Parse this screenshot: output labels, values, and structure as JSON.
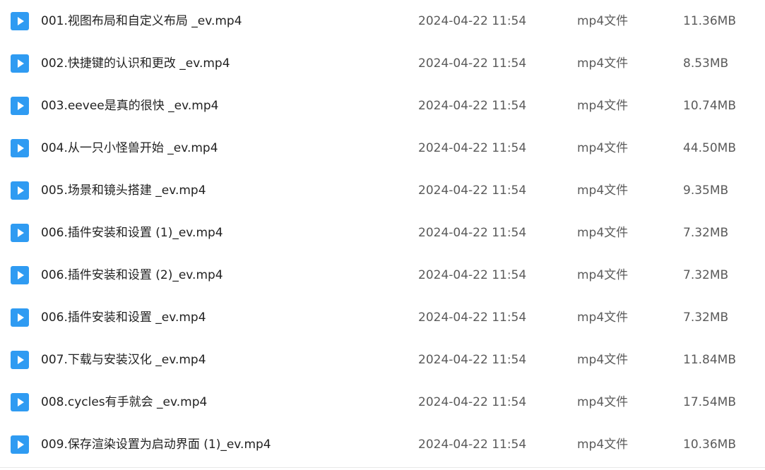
{
  "icons": {
    "file": "video-file-icon",
    "file_color": "#2f9bf2"
  },
  "files": [
    {
      "name": "001.视图布局和自定义布局 _ev.mp4",
      "modified": "2024-04-22 11:54",
      "type": "mp4文件",
      "size": "11.36MB"
    },
    {
      "name": "002.快捷键的认识和更改 _ev.mp4",
      "modified": "2024-04-22 11:54",
      "type": "mp4文件",
      "size": "8.53MB"
    },
    {
      "name": "003.eevee是真的很快 _ev.mp4",
      "modified": "2024-04-22 11:54",
      "type": "mp4文件",
      "size": "10.74MB"
    },
    {
      "name": "004.从一只小怪兽开始 _ev.mp4",
      "modified": "2024-04-22 11:54",
      "type": "mp4文件",
      "size": "44.50MB"
    },
    {
      "name": "005.场景和镜头搭建 _ev.mp4",
      "modified": "2024-04-22 11:54",
      "type": "mp4文件",
      "size": "9.35MB"
    },
    {
      "name": "006.插件安装和设置 (1)_ev.mp4",
      "modified": "2024-04-22 11:54",
      "type": "mp4文件",
      "size": "7.32MB"
    },
    {
      "name": "006.插件安装和设置 (2)_ev.mp4",
      "modified": "2024-04-22 11:54",
      "type": "mp4文件",
      "size": "7.32MB"
    },
    {
      "name": "006.插件安装和设置 _ev.mp4",
      "modified": "2024-04-22 11:54",
      "type": "mp4文件",
      "size": "7.32MB"
    },
    {
      "name": "007.下载与安装汉化 _ev.mp4",
      "modified": "2024-04-22 11:54",
      "type": "mp4文件",
      "size": "11.84MB"
    },
    {
      "name": "008.cycles有手就会 _ev.mp4",
      "modified": "2024-04-22 11:54",
      "type": "mp4文件",
      "size": "17.54MB"
    },
    {
      "name": "009.保存渲染设置为启动界面 (1)_ev.mp4",
      "modified": "2024-04-22 11:54",
      "type": "mp4文件",
      "size": "10.36MB"
    }
  ]
}
